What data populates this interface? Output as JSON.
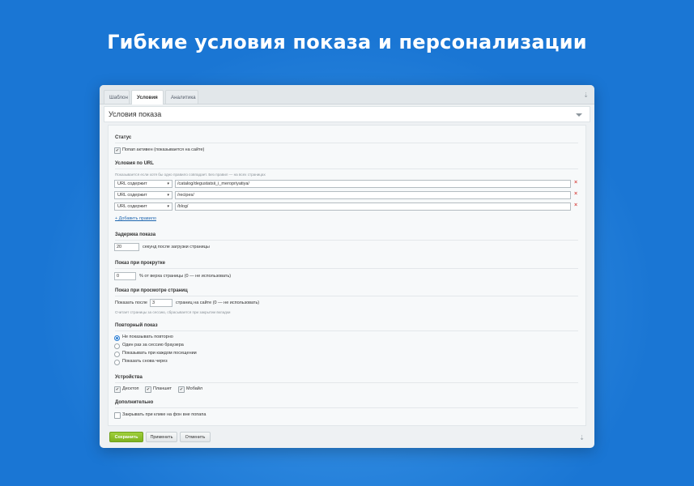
{
  "hero": {
    "title": "Гибкие условия показа и персонализации"
  },
  "tabs": [
    {
      "label": "Шаблон"
    },
    {
      "label": "Условия"
    },
    {
      "label": "Аналитика"
    }
  ],
  "section": {
    "title": "Условия показа"
  },
  "status": {
    "heading": "Статус",
    "active_label": "Попап активен (показывается на сайте)",
    "active_checked": true
  },
  "url_conditions": {
    "heading": "Условия по URL",
    "hint": "Показывается если хотя бы одно правило совпадает. Без правил — на всех страницах",
    "rules": [
      {
        "operator": "URL содержит",
        "value": "/catalog/degustatsii_i_meropriyatiya/"
      },
      {
        "operator": "URL содержит",
        "value": "/recipes/"
      },
      {
        "operator": "URL содержит",
        "value": "/blog/"
      }
    ],
    "delete_glyph": "×",
    "add_label": "+ Добавить правило"
  },
  "delay": {
    "heading": "Задержка показа",
    "value": "20",
    "suffix": "секунд после загрузки страницы"
  },
  "scroll": {
    "heading": "Показ при прокрутке",
    "value": "0",
    "suffix": "% от верха страницы (0 — не использовать)"
  },
  "pageviews": {
    "heading": "Показ при просмотре страниц",
    "prefix": "Показать после",
    "value": "3",
    "suffix": "страниц на сайте (0 — не использовать)",
    "hint": "Считает страницы за сессию, сбрасывается при закрытии вкладки"
  },
  "repeat": {
    "heading": "Повторный показ",
    "options": [
      {
        "label": "Не показывать повторно",
        "checked": true
      },
      {
        "label": "Один раз за сессию браузера",
        "checked": false
      },
      {
        "label": "Показывать при каждом посещении",
        "checked": false
      },
      {
        "label": "Показать снова через",
        "checked": false
      }
    ]
  },
  "devices": {
    "heading": "Устройства",
    "items": [
      {
        "label": "Десктоп",
        "checked": true
      },
      {
        "label": "Планшет",
        "checked": true
      },
      {
        "label": "Мобайл",
        "checked": true
      }
    ]
  },
  "extra": {
    "heading": "Дополнительно",
    "overlay_close_label": "Закрывать при клике на фон вне попапа",
    "overlay_close_checked": false
  },
  "footer": {
    "save": "Сохранить",
    "apply": "Применить",
    "cancel": "Отменить"
  },
  "icons": {
    "pin": "pin-icon",
    "collapse": "chevron-down-icon",
    "check": "✔",
    "select_arrow": "▾"
  },
  "colors": {
    "accent": "#7eb220",
    "link": "#2067b0",
    "delete": "#d9534f",
    "background": "#1a76d4"
  }
}
